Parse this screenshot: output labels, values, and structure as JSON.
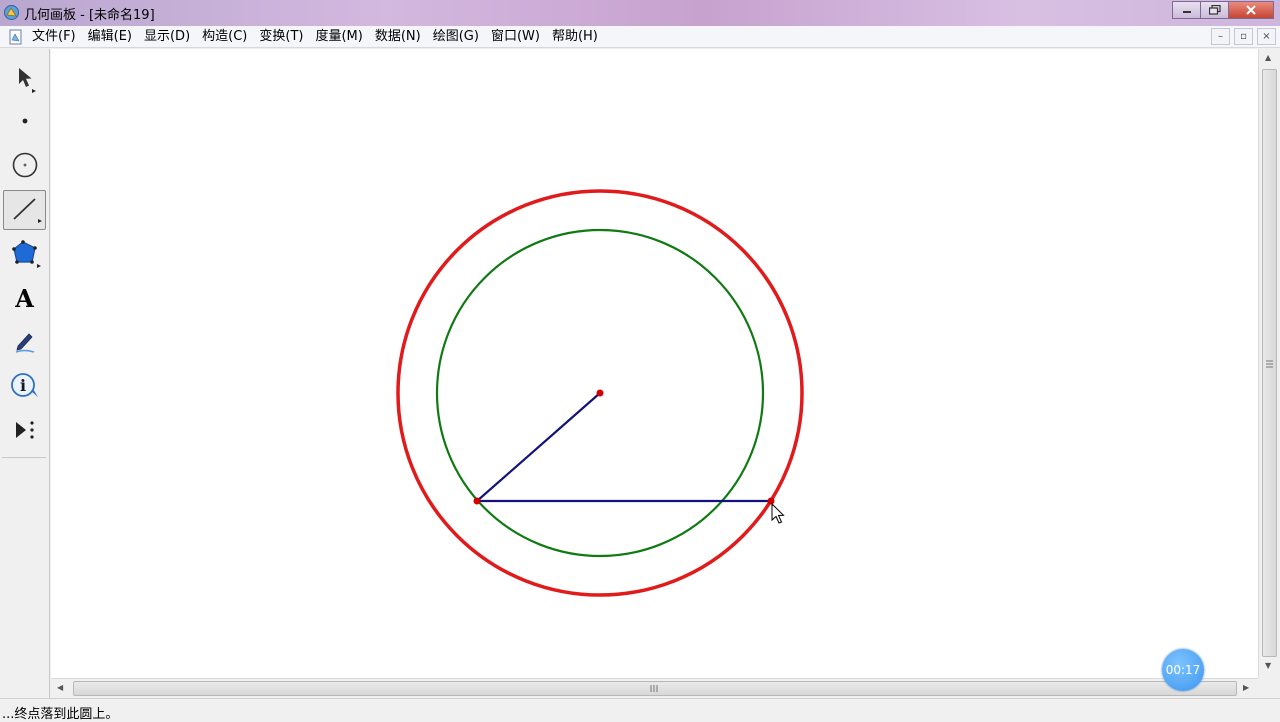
{
  "window": {
    "title": "几何画板 - [未命名19]",
    "minimize_label": "",
    "maximize_label": "",
    "close_label": ""
  },
  "menu": {
    "items": [
      "文件(F)",
      "编辑(E)",
      "显示(D)",
      "构造(C)",
      "变换(T)",
      "度量(M)",
      "数据(N)",
      "绘图(G)",
      "窗口(W)",
      "帮助(H)"
    ]
  },
  "doc_buttons": {
    "minimize": "–",
    "restore": "▫",
    "close": "×"
  },
  "tools": [
    {
      "name": "select-arrow-tool",
      "icon": "arrow-icon"
    },
    {
      "name": "point-tool",
      "icon": "point-icon"
    },
    {
      "name": "compass-tool",
      "icon": "circle-icon"
    },
    {
      "name": "straightedge-tool",
      "icon": "segment-icon",
      "active": true
    },
    {
      "name": "polygon-tool",
      "icon": "pentagon-icon"
    },
    {
      "name": "text-tool",
      "icon": "text-a-icon"
    },
    {
      "name": "marker-tool",
      "icon": "pen-icon"
    },
    {
      "name": "information-tool",
      "icon": "info-icon"
    },
    {
      "name": "custom-tool",
      "icon": "play-dots-icon"
    }
  ],
  "text_tool_glyph": "A",
  "info_tool_glyph": "i",
  "status": {
    "text": "...终点落到此圆上。"
  },
  "timer": {
    "text": "00:17"
  },
  "colors": {
    "outer_circle": "#e11b1b",
    "inner_circle": "#0f7a12",
    "segment": "#12127a",
    "point": "#d10000"
  }
}
